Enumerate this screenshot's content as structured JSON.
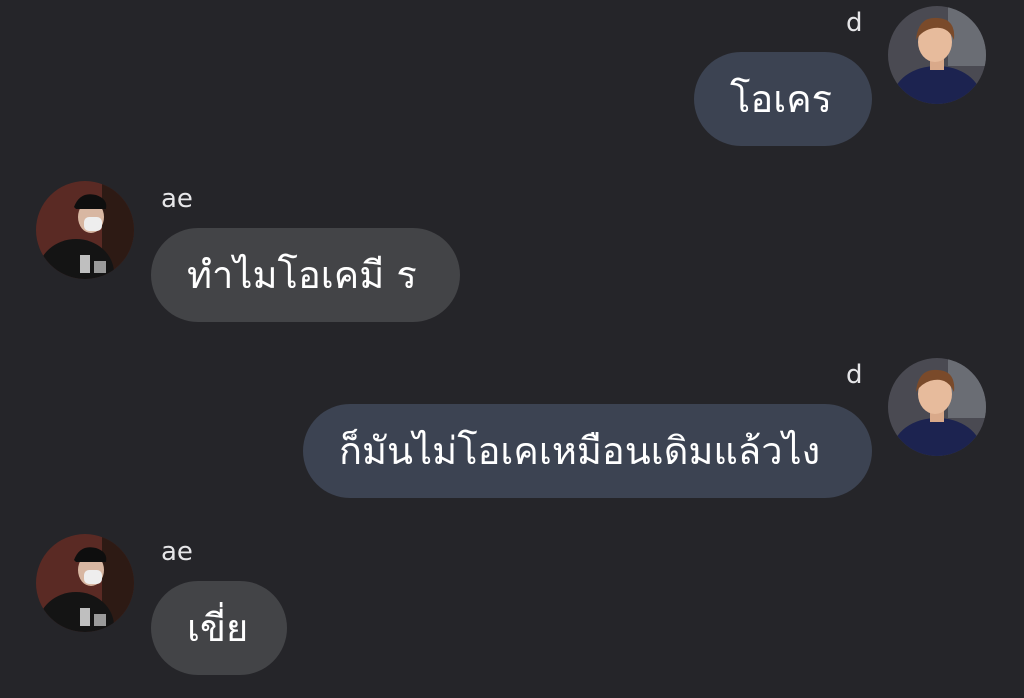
{
  "messages": [
    {
      "sender": "d",
      "direction": "outgoing",
      "text": "โอเคร",
      "avatar_icon": "avatar-d-icon"
    },
    {
      "sender": "ae",
      "direction": "incoming",
      "text": "ทำไมโอเคมี ร",
      "avatar_icon": "avatar-ae-icon"
    },
    {
      "sender": "d",
      "direction": "outgoing",
      "text": "ก็มันไม่โอเคเหมือนเดิมแล้วไง",
      "avatar_icon": "avatar-d-icon"
    },
    {
      "sender": "ae",
      "direction": "incoming",
      "text": "เขี่ย",
      "avatar_icon": "avatar-ae-icon"
    }
  ],
  "colors": {
    "background": "#252529",
    "outgoing_bubble": "#3c4352",
    "incoming_bubble": "#434447",
    "text": "#ffffff",
    "name_text": "#e6e6e8"
  }
}
